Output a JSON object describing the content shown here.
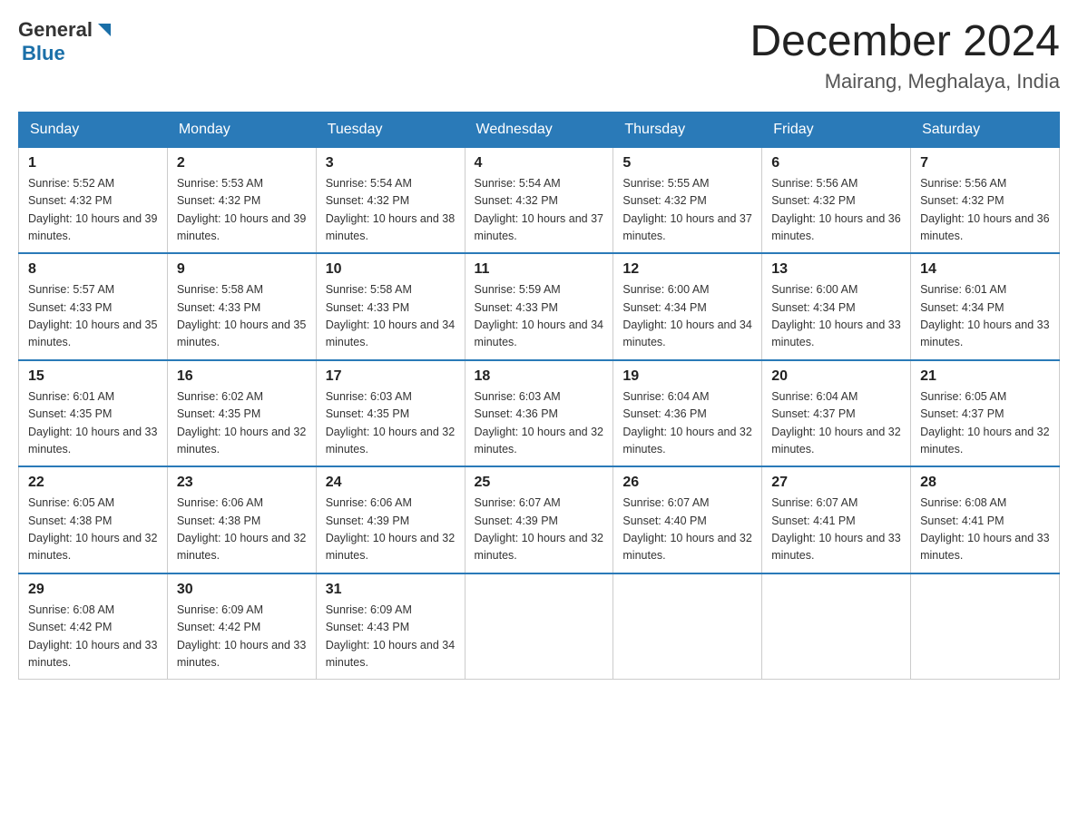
{
  "header": {
    "logo_general": "General",
    "logo_blue": "Blue",
    "month_title": "December 2024",
    "location": "Mairang, Meghalaya, India"
  },
  "days_of_week": [
    "Sunday",
    "Monday",
    "Tuesday",
    "Wednesday",
    "Thursday",
    "Friday",
    "Saturday"
  ],
  "weeks": [
    [
      {
        "day": "1",
        "sunrise": "5:52 AM",
        "sunset": "4:32 PM",
        "daylight": "10 hours and 39 minutes."
      },
      {
        "day": "2",
        "sunrise": "5:53 AM",
        "sunset": "4:32 PM",
        "daylight": "10 hours and 39 minutes."
      },
      {
        "day": "3",
        "sunrise": "5:54 AM",
        "sunset": "4:32 PM",
        "daylight": "10 hours and 38 minutes."
      },
      {
        "day": "4",
        "sunrise": "5:54 AM",
        "sunset": "4:32 PM",
        "daylight": "10 hours and 37 minutes."
      },
      {
        "day": "5",
        "sunrise": "5:55 AM",
        "sunset": "4:32 PM",
        "daylight": "10 hours and 37 minutes."
      },
      {
        "day": "6",
        "sunrise": "5:56 AM",
        "sunset": "4:32 PM",
        "daylight": "10 hours and 36 minutes."
      },
      {
        "day": "7",
        "sunrise": "5:56 AM",
        "sunset": "4:32 PM",
        "daylight": "10 hours and 36 minutes."
      }
    ],
    [
      {
        "day": "8",
        "sunrise": "5:57 AM",
        "sunset": "4:33 PM",
        "daylight": "10 hours and 35 minutes."
      },
      {
        "day": "9",
        "sunrise": "5:58 AM",
        "sunset": "4:33 PM",
        "daylight": "10 hours and 35 minutes."
      },
      {
        "day": "10",
        "sunrise": "5:58 AM",
        "sunset": "4:33 PM",
        "daylight": "10 hours and 34 minutes."
      },
      {
        "day": "11",
        "sunrise": "5:59 AM",
        "sunset": "4:33 PM",
        "daylight": "10 hours and 34 minutes."
      },
      {
        "day": "12",
        "sunrise": "6:00 AM",
        "sunset": "4:34 PM",
        "daylight": "10 hours and 34 minutes."
      },
      {
        "day": "13",
        "sunrise": "6:00 AM",
        "sunset": "4:34 PM",
        "daylight": "10 hours and 33 minutes."
      },
      {
        "day": "14",
        "sunrise": "6:01 AM",
        "sunset": "4:34 PM",
        "daylight": "10 hours and 33 minutes."
      }
    ],
    [
      {
        "day": "15",
        "sunrise": "6:01 AM",
        "sunset": "4:35 PM",
        "daylight": "10 hours and 33 minutes."
      },
      {
        "day": "16",
        "sunrise": "6:02 AM",
        "sunset": "4:35 PM",
        "daylight": "10 hours and 32 minutes."
      },
      {
        "day": "17",
        "sunrise": "6:03 AM",
        "sunset": "4:35 PM",
        "daylight": "10 hours and 32 minutes."
      },
      {
        "day": "18",
        "sunrise": "6:03 AM",
        "sunset": "4:36 PM",
        "daylight": "10 hours and 32 minutes."
      },
      {
        "day": "19",
        "sunrise": "6:04 AM",
        "sunset": "4:36 PM",
        "daylight": "10 hours and 32 minutes."
      },
      {
        "day": "20",
        "sunrise": "6:04 AM",
        "sunset": "4:37 PM",
        "daylight": "10 hours and 32 minutes."
      },
      {
        "day": "21",
        "sunrise": "6:05 AM",
        "sunset": "4:37 PM",
        "daylight": "10 hours and 32 minutes."
      }
    ],
    [
      {
        "day": "22",
        "sunrise": "6:05 AM",
        "sunset": "4:38 PM",
        "daylight": "10 hours and 32 minutes."
      },
      {
        "day": "23",
        "sunrise": "6:06 AM",
        "sunset": "4:38 PM",
        "daylight": "10 hours and 32 minutes."
      },
      {
        "day": "24",
        "sunrise": "6:06 AM",
        "sunset": "4:39 PM",
        "daylight": "10 hours and 32 minutes."
      },
      {
        "day": "25",
        "sunrise": "6:07 AM",
        "sunset": "4:39 PM",
        "daylight": "10 hours and 32 minutes."
      },
      {
        "day": "26",
        "sunrise": "6:07 AM",
        "sunset": "4:40 PM",
        "daylight": "10 hours and 32 minutes."
      },
      {
        "day": "27",
        "sunrise": "6:07 AM",
        "sunset": "4:41 PM",
        "daylight": "10 hours and 33 minutes."
      },
      {
        "day": "28",
        "sunrise": "6:08 AM",
        "sunset": "4:41 PM",
        "daylight": "10 hours and 33 minutes."
      }
    ],
    [
      {
        "day": "29",
        "sunrise": "6:08 AM",
        "sunset": "4:42 PM",
        "daylight": "10 hours and 33 minutes."
      },
      {
        "day": "30",
        "sunrise": "6:09 AM",
        "sunset": "4:42 PM",
        "daylight": "10 hours and 33 minutes."
      },
      {
        "day": "31",
        "sunrise": "6:09 AM",
        "sunset": "4:43 PM",
        "daylight": "10 hours and 34 minutes."
      },
      null,
      null,
      null,
      null
    ]
  ],
  "labels": {
    "sunrise": "Sunrise: ",
    "sunset": "Sunset: ",
    "daylight": "Daylight: "
  }
}
